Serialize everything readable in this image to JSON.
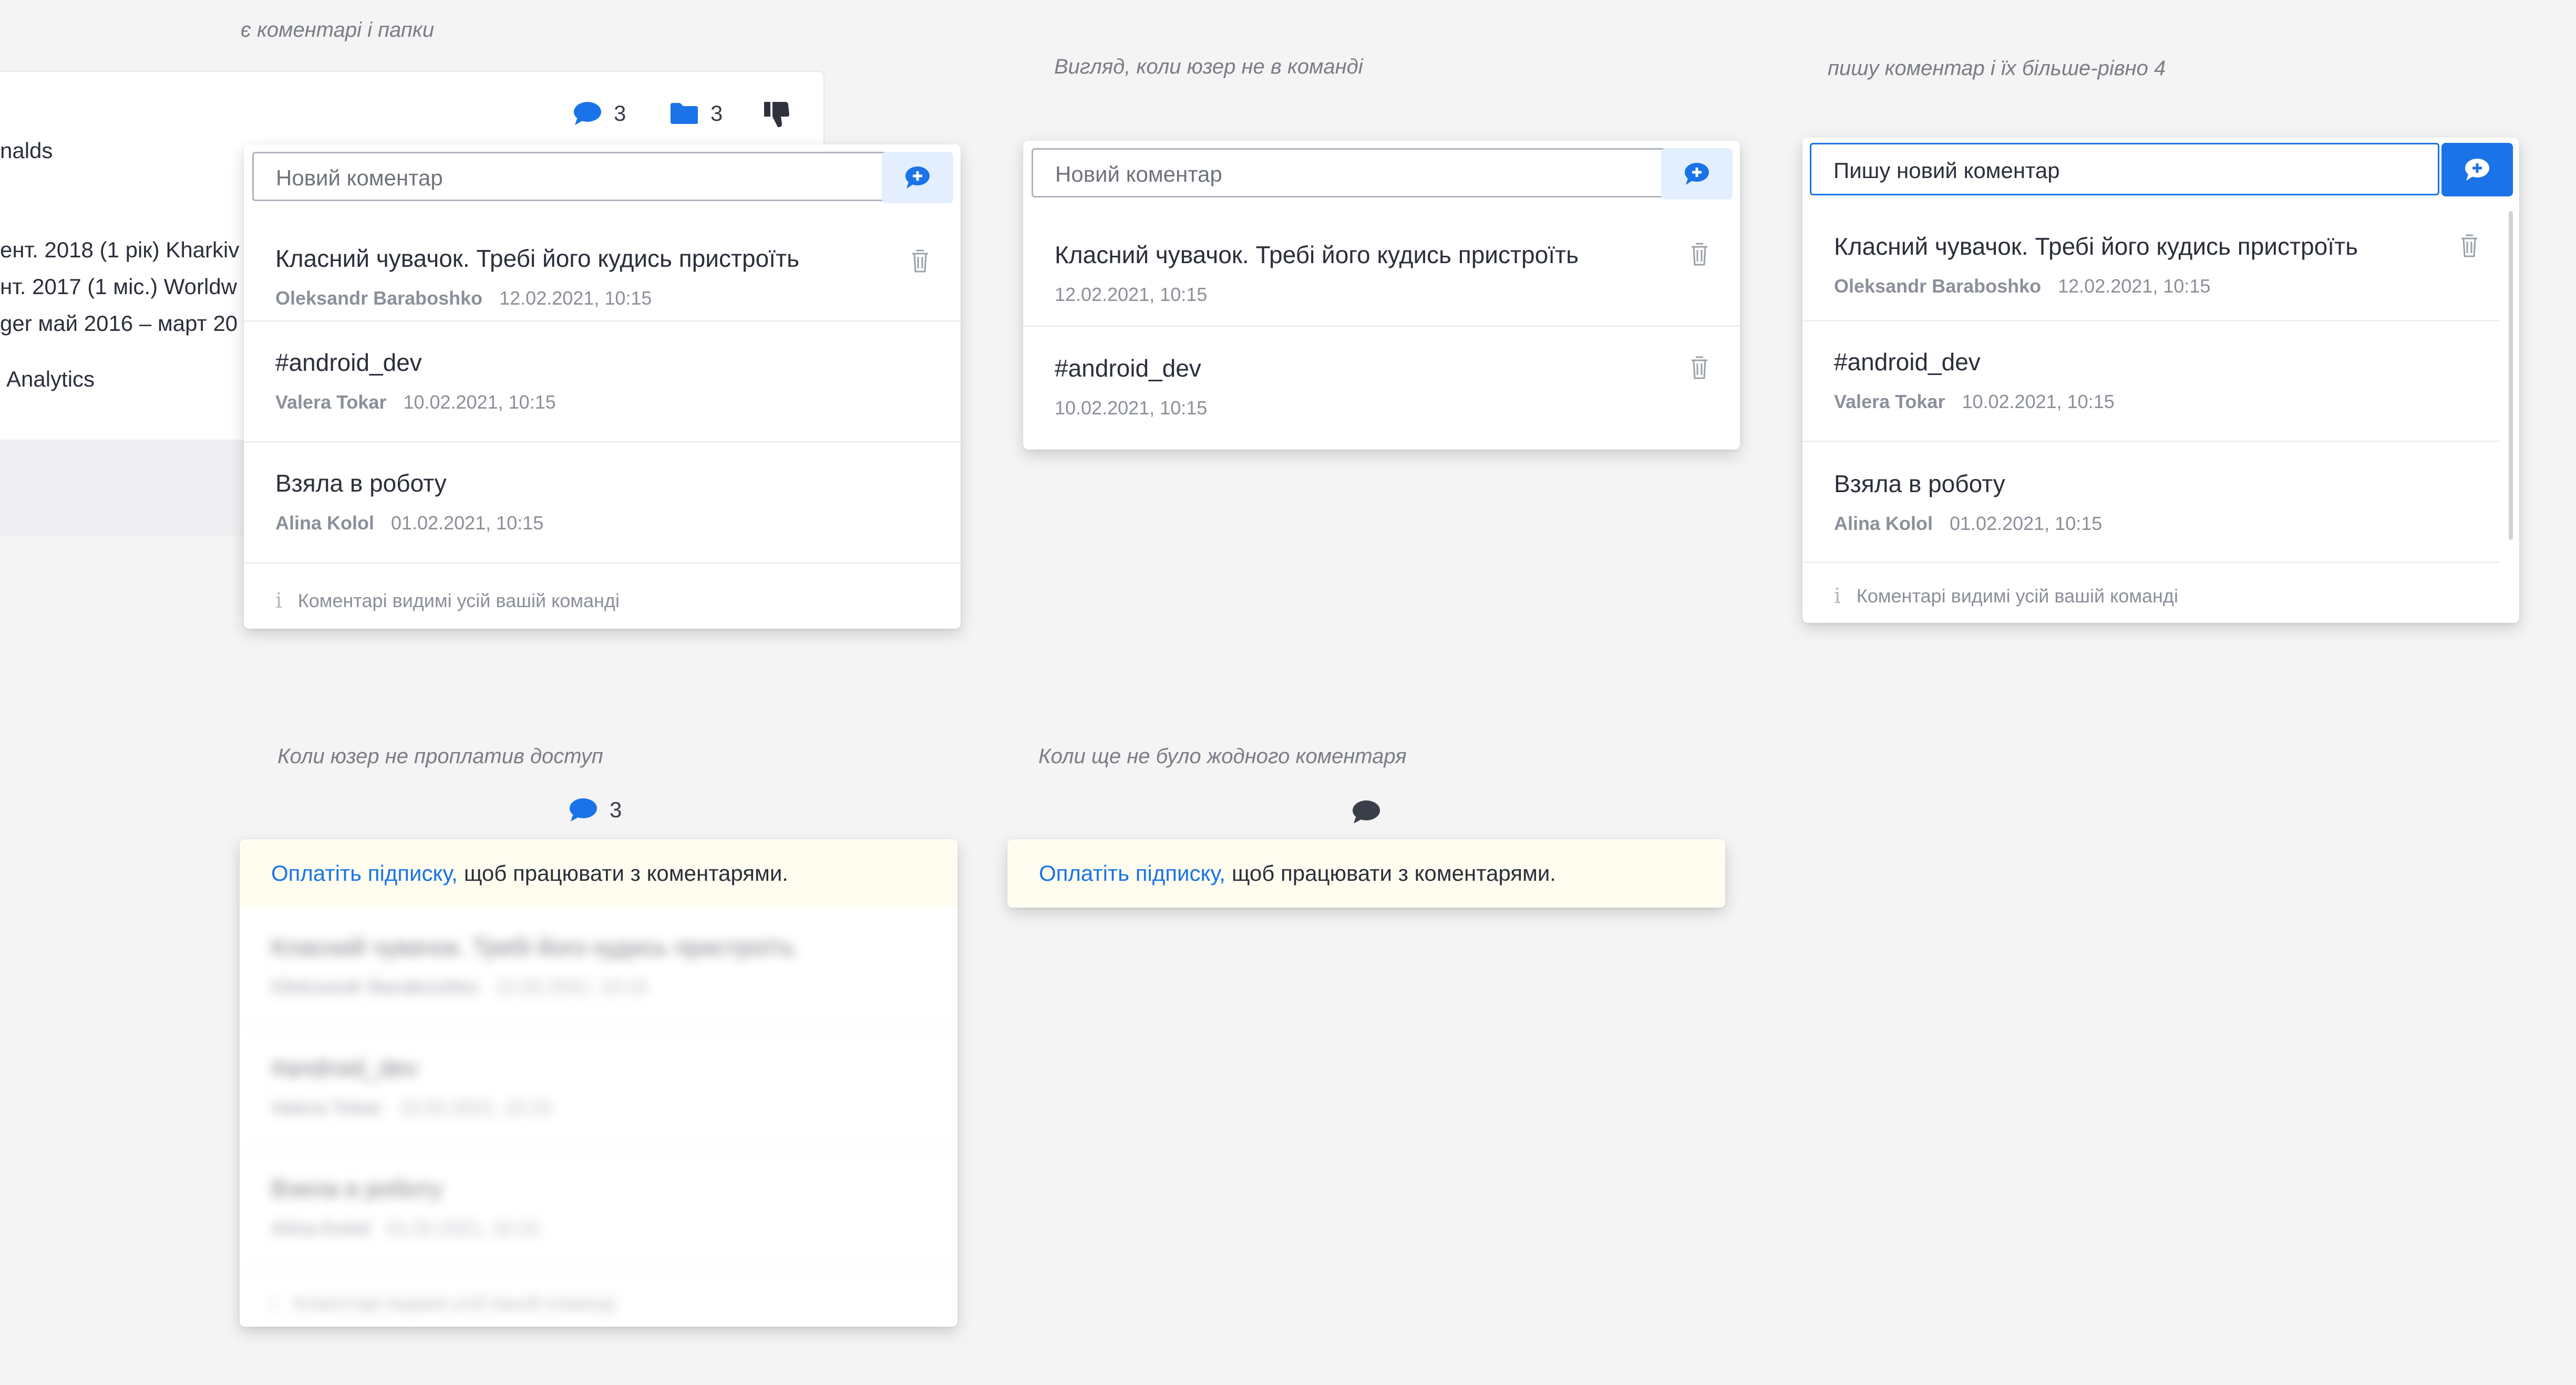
{
  "captions": {
    "folders": "є коментарі і папки",
    "not_in_team": "Вигляд, коли юзер не в команді",
    "writing": "пишу коментар і їх більше-рівно 4",
    "unpaid": "Коли юзер не проплатив доступ",
    "no_comments": "Коли ще не було жодного коментаря"
  },
  "profile": {
    "line1": "nalds",
    "line2": "ент. 2018 (1 рік) Kharkiv",
    "line3": "нт. 2017 (1 міс.) Worldw",
    "line4": "ger май 2016 – март 20",
    "line5": "Analytics"
  },
  "stats": {
    "comments": "3",
    "folders": "3"
  },
  "input": {
    "placeholder": "Новий коментар",
    "typed": "Пишу новий коментар"
  },
  "comments": [
    {
      "text": "Класний чувачок. Требі його кудись пристроїть",
      "author": "Oleksandr Baraboshko",
      "date": "12.02.2021, 10:15"
    },
    {
      "text": "#android_dev",
      "author": "Valera Tokar",
      "date": "10.02.2021, 10:15"
    },
    {
      "text": "Взяла в роботу",
      "author": "Alina Kolol",
      "date": "01.02.2021, 10:15"
    }
  ],
  "info_note": "Коментарі видимі усій вашій команді",
  "unpaid": {
    "count": "3",
    "link": "Оплатіть підписку,",
    "rest": "щоб працювати з коментарями."
  },
  "colors": {
    "accent": "#1a73e8",
    "paywall_bg": "#fffdf0",
    "canvas": "#f4f4f4"
  }
}
